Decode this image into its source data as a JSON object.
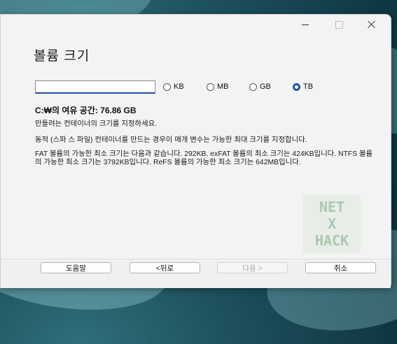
{
  "window": {
    "title": "볼륨 크기",
    "caption_close": "✕"
  },
  "size": {
    "input_value": "",
    "units": [
      {
        "label": "KB",
        "checked": false
      },
      {
        "label": "MB",
        "checked": false
      },
      {
        "label": "GB",
        "checked": false
      },
      {
        "label": "TB",
        "checked": true
      }
    ]
  },
  "info": {
    "free_space": "C:₩의 여유 공간: 76.86 GB",
    "line1": "만들려는 컨테이너의 크기를 지정하세요.",
    "line2": "동적 (스파 스 파일) 컨테이너를 만드는 경우이 매개 변수는 가능한 최대 크기를 지정합니다.",
    "line3": "FAT 볼륨의 가능한 최소 크기는 다음과 같습니다. 292KB. exFAT 볼륨의 최소 크기는 424KB입니다. NTFS 볼륨의 가능한 최소 크기는 3792KB입니다. ReFS 볼륨의 가능한 최소 크기는 642MB입니다."
  },
  "watermark": {
    "line1": "NET",
    "line2": "X",
    "line3": "HACK"
  },
  "footer": {
    "help": "도움말",
    "back": "<뒤로",
    "next": "다음 >",
    "cancel": "취소"
  }
}
